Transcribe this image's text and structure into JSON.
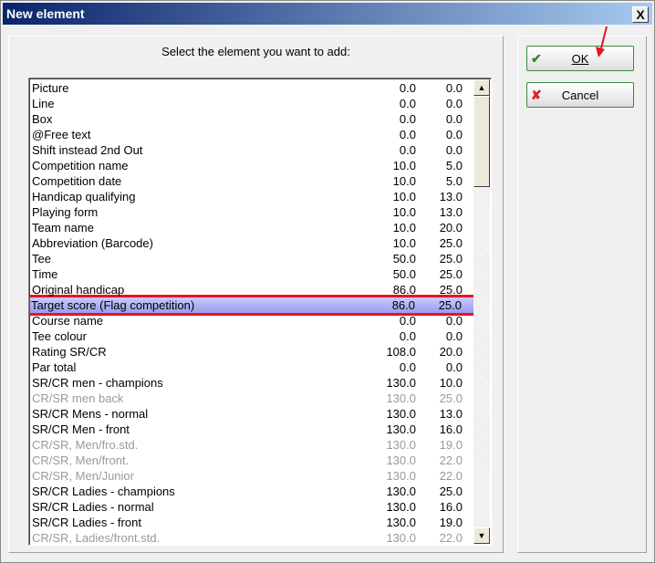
{
  "window": {
    "title": "New element",
    "close": "X"
  },
  "prompt": "Select the element you want to add:",
  "buttons": {
    "ok": "OK",
    "cancel": "Cancel"
  },
  "colors": {
    "selection_outline": "#e8141e",
    "selection_fill": "#b4b4f8",
    "disabled_text": "#999999"
  },
  "rows": [
    {
      "name": "Picture",
      "a": "0.0",
      "b": "0.0",
      "disabled": false
    },
    {
      "name": "Line",
      "a": "0.0",
      "b": "0.0",
      "disabled": false
    },
    {
      "name": "Box",
      "a": "0.0",
      "b": "0.0",
      "disabled": false
    },
    {
      "name": "@Free text",
      "a": "0.0",
      "b": "0.0",
      "disabled": false
    },
    {
      "name": "Shift instead 2nd Out",
      "a": "0.0",
      "b": "0.0",
      "disabled": false
    },
    {
      "name": "Competition name",
      "a": "10.0",
      "b": "5.0",
      "disabled": false
    },
    {
      "name": "Competition date",
      "a": "10.0",
      "b": "5.0",
      "disabled": false
    },
    {
      "name": "Handicap qualifying",
      "a": "10.0",
      "b": "13.0",
      "disabled": false
    },
    {
      "name": "Playing form",
      "a": "10.0",
      "b": "13.0",
      "disabled": false
    },
    {
      "name": "Team name",
      "a": "10.0",
      "b": "20.0",
      "disabled": false
    },
    {
      "name": "Abbreviation (Barcode)",
      "a": "10.0",
      "b": "25.0",
      "disabled": false
    },
    {
      "name": "Tee",
      "a": "50.0",
      "b": "25.0",
      "disabled": false
    },
    {
      "name": "Time",
      "a": "50.0",
      "b": "25.0",
      "disabled": false
    },
    {
      "name": "Original handicap",
      "a": "86.0",
      "b": "25.0",
      "disabled": false
    },
    {
      "name": "Target score (Flag competition)",
      "a": "86.0",
      "b": "25.0",
      "disabled": false,
      "selected": true
    },
    {
      "name": "Course name",
      "a": "0.0",
      "b": "0.0",
      "disabled": false
    },
    {
      "name": "Tee colour",
      "a": "0.0",
      "b": "0.0",
      "disabled": false
    },
    {
      "name": "Rating SR/CR",
      "a": "108.0",
      "b": "20.0",
      "disabled": false
    },
    {
      "name": "Par total",
      "a": "0.0",
      "b": "0.0",
      "disabled": false
    },
    {
      "name": "SR/CR men - champions",
      "a": "130.0",
      "b": "10.0",
      "disabled": false
    },
    {
      "name": "CR/SR men back",
      "a": "130.0",
      "b": "25.0",
      "disabled": true
    },
    {
      "name": "SR/CR Mens - normal",
      "a": "130.0",
      "b": "13.0",
      "disabled": false
    },
    {
      "name": "SR/CR Men - front",
      "a": "130.0",
      "b": "16.0",
      "disabled": false
    },
    {
      "name": "CR/SR, Men/fro.std.",
      "a": "130.0",
      "b": "19.0",
      "disabled": true
    },
    {
      "name": "CR/SR, Men/front.",
      "a": "130.0",
      "b": "22.0",
      "disabled": true
    },
    {
      "name": "CR/SR, Men/Junior",
      "a": "130.0",
      "b": "22.0",
      "disabled": true
    },
    {
      "name": "SR/CR Ladies - champions",
      "a": "130.0",
      "b": "25.0",
      "disabled": false
    },
    {
      "name": "SR/CR Ladies - normal",
      "a": "130.0",
      "b": "16.0",
      "disabled": false
    },
    {
      "name": "SR/CR Ladies - front",
      "a": "130.0",
      "b": "19.0",
      "disabled": false
    },
    {
      "name": "CR/SR, Ladies/front.std.",
      "a": "130.0",
      "b": "22.0",
      "disabled": true
    }
  ]
}
